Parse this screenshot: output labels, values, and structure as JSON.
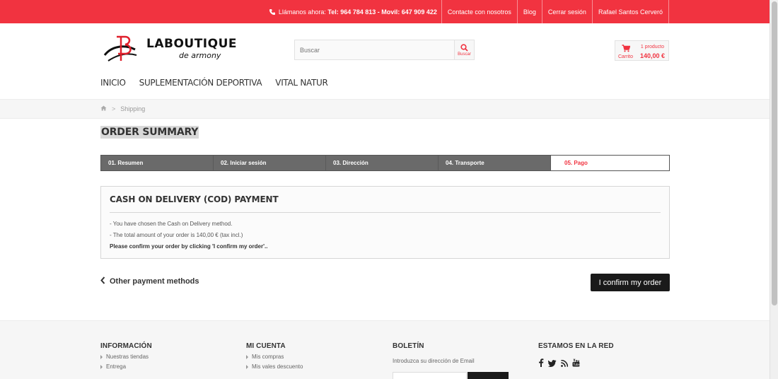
{
  "topbar": {
    "call_label": "Llámanos ahora:",
    "phone_numbers": "Tel: 964 784 813 - Movil: 647 909 422",
    "links": [
      "Contacte con nosotros",
      "Blog",
      "Cerrar sesión",
      "Rafael Santos Cerveró"
    ]
  },
  "header": {
    "logo_text": "LABOUTIQUE",
    "logo_sub": "de armony",
    "search_placeholder": "Buscar",
    "search_button_label": "Buscar",
    "cart_label": "Carrito",
    "cart_count": "1 producto",
    "cart_total": "140,00 €"
  },
  "nav": {
    "items": [
      "INICIO",
      "SUPLEMENTACIÓN DEPORTIVA",
      "VITAL NATUR"
    ]
  },
  "breadcrumb": {
    "separator": ">",
    "current": "Shipping"
  },
  "page": {
    "title": "ORDER SUMMARY"
  },
  "steps": [
    "01. Resumen",
    "02. Iniciar sesión",
    "03. Dirección",
    "04. Transporte",
    "05. Pago"
  ],
  "payment": {
    "heading": "CASH ON DELIVERY (COD) PAYMENT",
    "line1": "- You have chosen the Cash on Delivery method.",
    "line2": "- The total amount of your order is 140,00 € (tax incl.)",
    "line3": "Please confirm your order by clicking 'I confirm my order'.."
  },
  "actions": {
    "back_label": "Other payment methods",
    "confirm_label": "I confirm my order"
  },
  "footer": {
    "info_heading": "INFORMACIÓN",
    "info_items": [
      "Nuestras tiendas",
      "Entrega"
    ],
    "account_heading": "MI CUENTA",
    "account_items": [
      "Mis compras",
      "Mis vales descuento"
    ],
    "newsletter_heading": "BOLETÍN",
    "newsletter_text": "Introduzca su dirección de Email",
    "social_heading": "ESTAMOS EN LA RED",
    "social_icons": [
      "facebook-icon",
      "twitter-icon",
      "rss-icon",
      "youtube-icon"
    ]
  },
  "colors": {
    "accent": "#f13340",
    "dark": "#1a1a1a",
    "step_bg": "#6a6a6a"
  }
}
